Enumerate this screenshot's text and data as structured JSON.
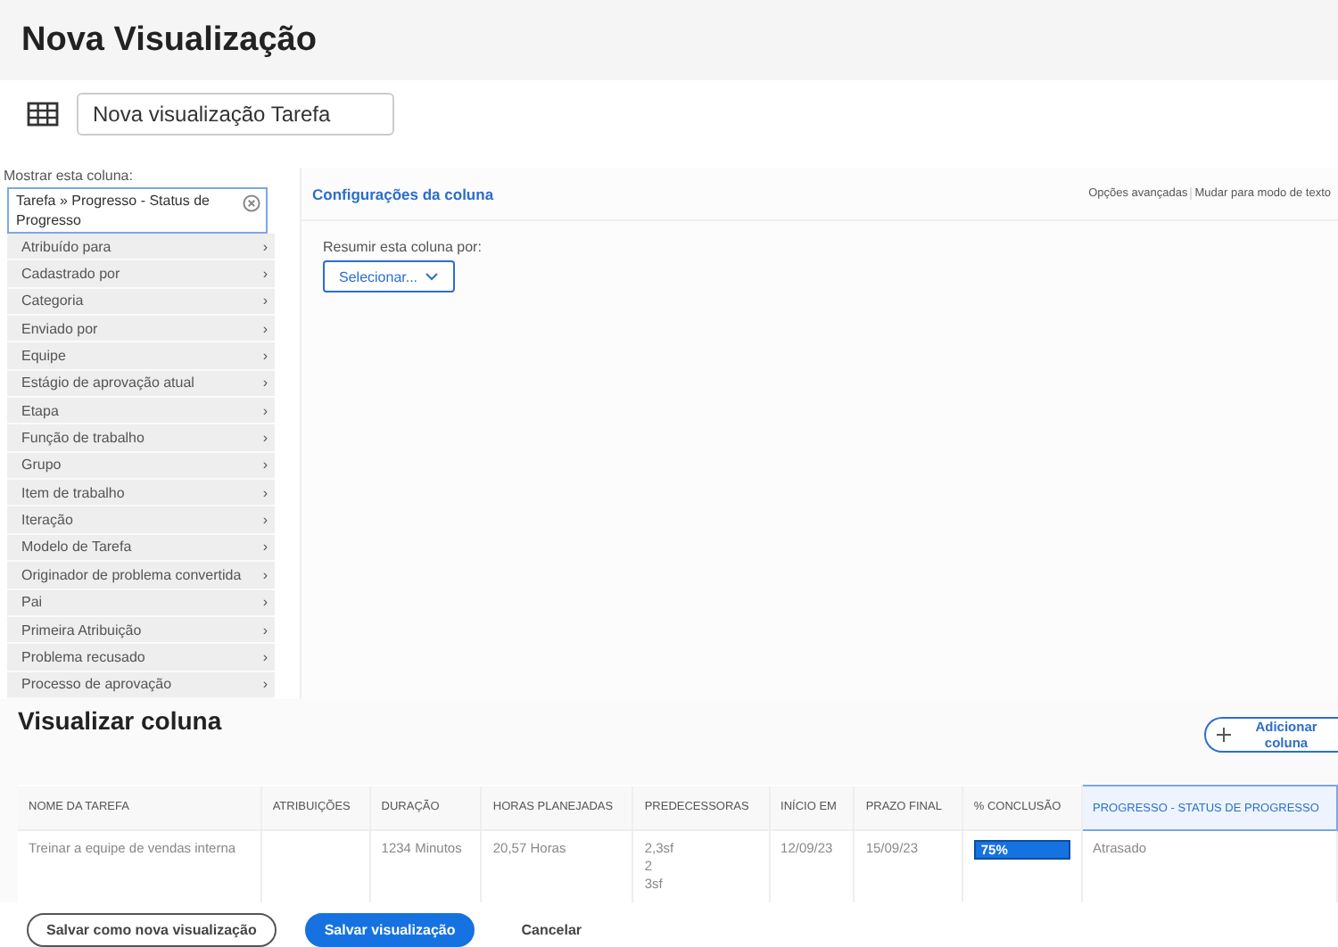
{
  "title": "Nova Visualização",
  "view_name": {
    "value": "Nova visualização Tarefa"
  },
  "column_picker": {
    "label": "Mostrar esta coluna:",
    "path": "Tarefa",
    "arrow": "»",
    "field": "Progresso - Status de Progresso",
    "items": [
      {
        "label": "Atribuído para",
        "chevron": "›"
      },
      {
        "label": "Cadastrado por",
        "chevron": "›"
      },
      {
        "label": "Categoria",
        "chevron": "›"
      },
      {
        "label": "Enviado por",
        "chevron": "›"
      },
      {
        "label": "Equipe",
        "chevron": "›"
      },
      {
        "label": "Estágio de aprovação atual",
        "chevron": "›"
      },
      {
        "label": "Etapa",
        "chevron": "›"
      },
      {
        "label": "Função de trabalho",
        "chevron": "›"
      },
      {
        "label": "Grupo",
        "chevron": "›"
      },
      {
        "label": "Item de trabalho",
        "chevron": "›"
      },
      {
        "label": "Iteração",
        "chevron": "›"
      },
      {
        "label": "Modelo de Tarefa",
        "chevron": "›"
      },
      {
        "label": "Originador de problema convertida",
        "chevron": "›"
      },
      {
        "label": "Pai",
        "chevron": "›"
      },
      {
        "label": "Primeira Atribuição",
        "chevron": "›"
      },
      {
        "label": "Problema recusado",
        "chevron": "›"
      },
      {
        "label": "Processo de aprovação",
        "chevron": "›"
      }
    ]
  },
  "settings": {
    "title": "Configurações da coluna",
    "advanced": "Opções avançadas",
    "text_mode": "Mudar para modo de texto",
    "summarize_label": "Resumir esta coluna por:",
    "summarize_select": "Selecionar..."
  },
  "preview": {
    "title": "Visualizar coluna",
    "add_button": "Adicionar coluna",
    "columns": [
      {
        "label": "NOME DA TAREFA",
        "selected": false
      },
      {
        "label": "ATRIBUIÇÕES",
        "selected": false
      },
      {
        "label": "DURAÇÃO",
        "selected": false
      },
      {
        "label": "HORAS PLANEJADAS",
        "selected": false
      },
      {
        "label": "PREDECESSORAS",
        "selected": false
      },
      {
        "label": "INÍCIO EM",
        "selected": false
      },
      {
        "label": "PRAZO FINAL",
        "selected": false
      },
      {
        "label": "% CONCLUSÃO",
        "selected": false
      },
      {
        "label": "PROGRESSO - STATUS DE PROGRESSO",
        "selected": true
      }
    ],
    "row": [
      {
        "kind": "text",
        "lines": [
          "Treinar a equipe de vendas interna"
        ]
      },
      {
        "kind": "empty"
      },
      {
        "kind": "text",
        "lines": [
          "1234 Minutos"
        ]
      },
      {
        "kind": "text",
        "lines": [
          "20,57 Horas"
        ]
      },
      {
        "kind": "text",
        "lines": [
          "2,3sf",
          "2",
          "3sf"
        ]
      },
      {
        "kind": "text",
        "lines": [
          "12/09/23"
        ]
      },
      {
        "kind": "text",
        "lines": [
          "15/09/23"
        ]
      },
      {
        "kind": "percent",
        "lines": [
          "75%"
        ]
      },
      {
        "kind": "text",
        "lines": [
          "Atrasado"
        ]
      }
    ]
  },
  "footer": {
    "save_new": "Salvar como nova visualização",
    "save": "Salvar visualização",
    "cancel": "Cancelar"
  }
}
